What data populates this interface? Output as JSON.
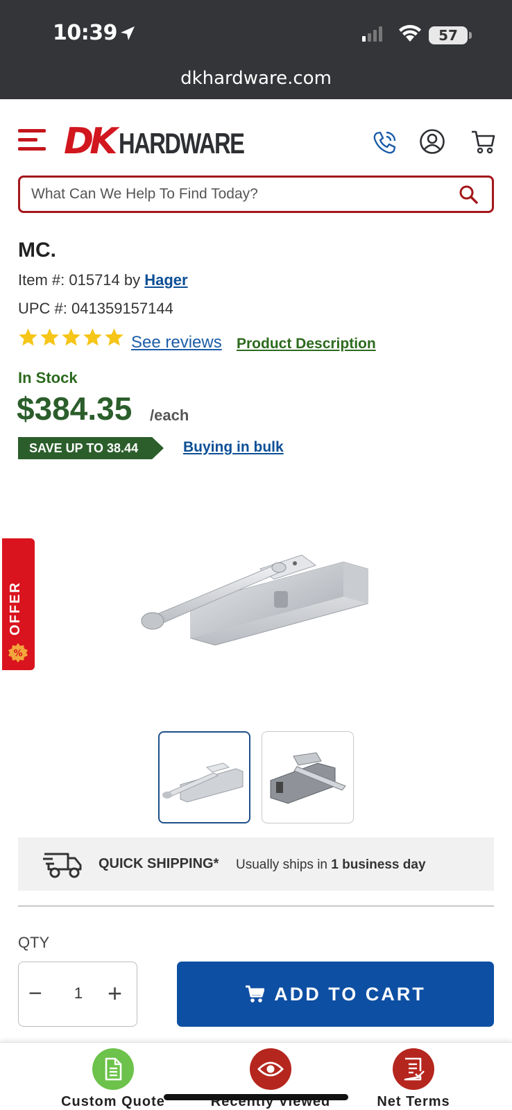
{
  "status_bar": {
    "time": "10:39",
    "battery": "57",
    "url": "dkhardware.com"
  },
  "header": {
    "logo_dk": "DK",
    "logo_hardware": "HARDWARE",
    "search_placeholder": "What Can We Help To Find Today?"
  },
  "product": {
    "title": "MC.",
    "item_label": "Item #: 015714 by",
    "brand": "Hager",
    "upc": "UPC #: 041359157144",
    "rating_stars": 5,
    "see_reviews": "See reviews",
    "product_description": "Product Description",
    "stock": "In Stock",
    "price": "$384.35",
    "per": "/each",
    "save_badge": "SAVE UP TO 38.44",
    "bulk_link": "Buying in bulk"
  },
  "offer_tab": {
    "label": "OFFER"
  },
  "shipping": {
    "label": "QUICK SHIPPING*",
    "desc_prefix": "Usually ships in",
    "desc_bold": "1 business day"
  },
  "purchase": {
    "qty_label": "QTY",
    "qty_value": "1",
    "add_to_cart": "ADD TO CART"
  },
  "bottom_nav": {
    "items": [
      {
        "label": "Custom Quote",
        "icon": "document-icon",
        "color": "#6cc24a"
      },
      {
        "label": "Recently Viewed",
        "icon": "eye-icon",
        "color": "#b5261e"
      },
      {
        "label": "Net Terms",
        "icon": "invoice-check-icon",
        "color": "#b5261e"
      }
    ]
  },
  "colors": {
    "brand_red": "#c4161c",
    "price_green": "#2b5e2b",
    "cart_blue": "#0d4fa3",
    "link_blue": "#0d4f96"
  }
}
